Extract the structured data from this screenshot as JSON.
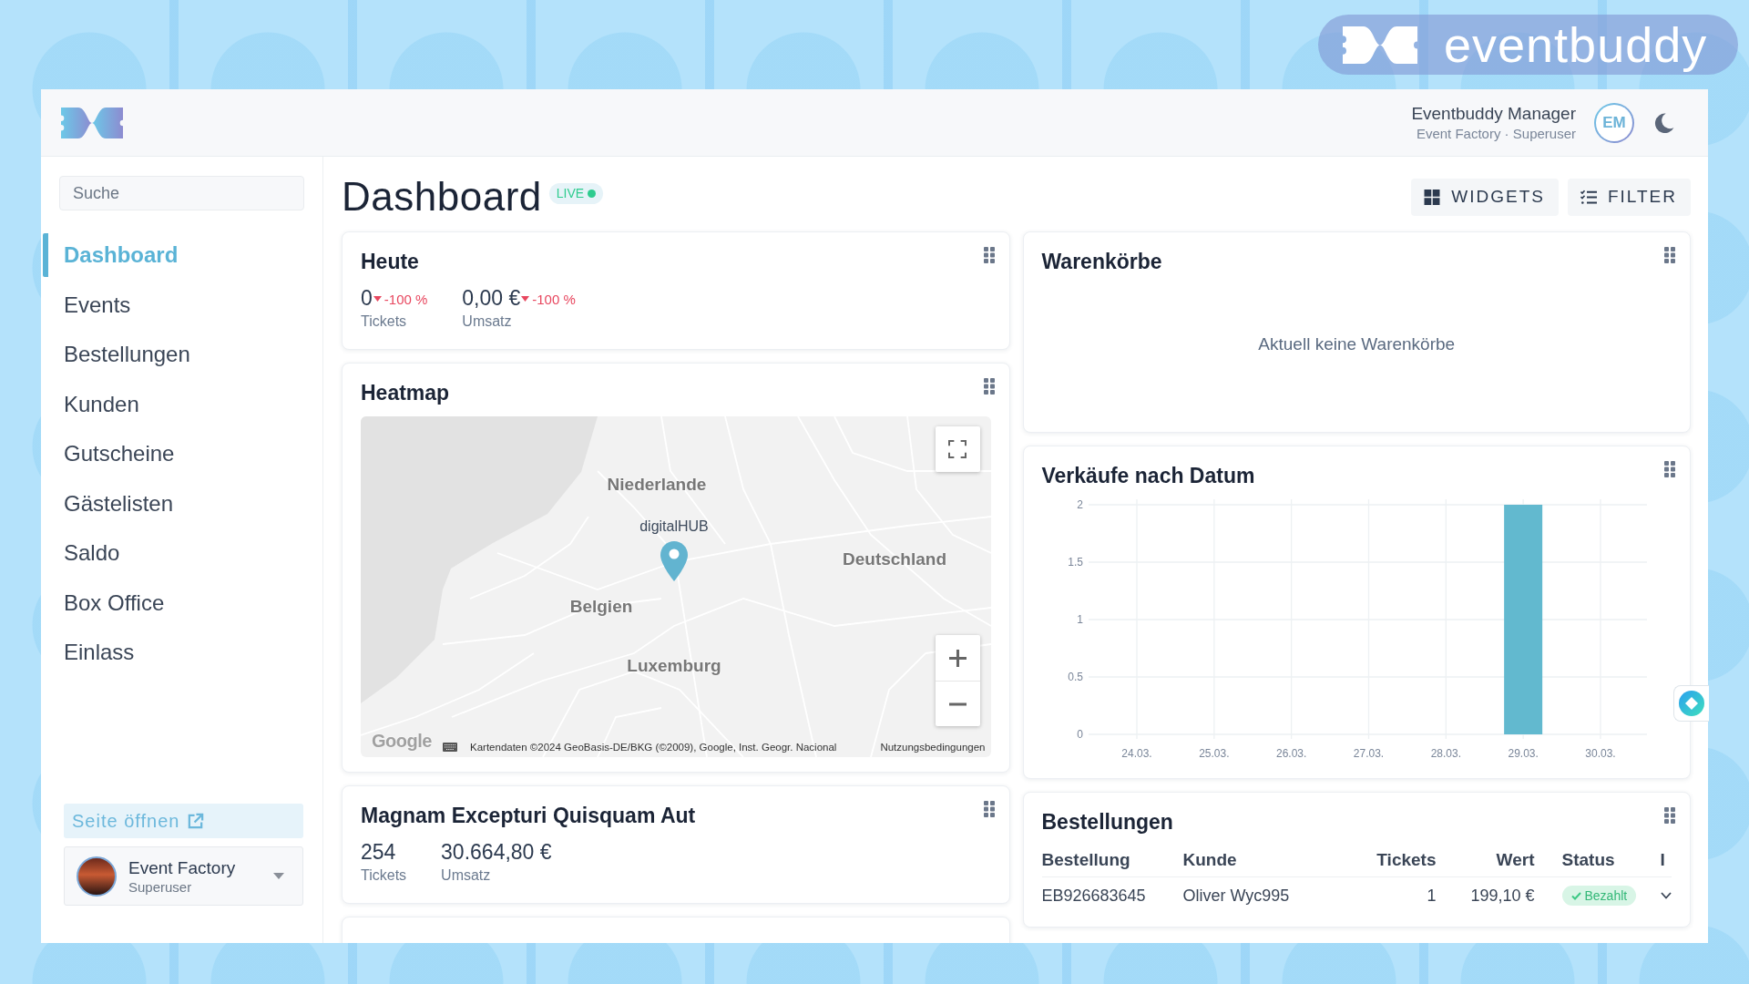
{
  "brand_badge": {
    "wordmark": "eventbuddy"
  },
  "header": {
    "user_name": "Eventbuddy Manager",
    "user_subtitle": "Event Factory · Superuser",
    "avatar_initials": "EM"
  },
  "sidebar": {
    "search": {
      "placeholder": "Suche"
    },
    "items": [
      {
        "label": "Dashboard",
        "selected": true
      },
      {
        "label": "Events",
        "selected": false
      },
      {
        "label": "Bestellungen",
        "selected": false
      },
      {
        "label": "Kunden",
        "selected": false
      },
      {
        "label": "Gutscheine",
        "selected": false
      },
      {
        "label": "Gästelisten",
        "selected": false
      },
      {
        "label": "Saldo",
        "selected": false
      },
      {
        "label": "Box Office",
        "selected": false
      },
      {
        "label": "Einlass",
        "selected": false
      }
    ],
    "open_site_button": "Seite öffnen",
    "organization": {
      "name": "Event Factory",
      "role": "Superuser"
    }
  },
  "page": {
    "title": "Dashboard",
    "live_badge": "LIVE",
    "buttons": [
      {
        "kind": "widgets",
        "label": "WIDGETS"
      },
      {
        "kind": "filter",
        "label": "FILTER"
      }
    ]
  },
  "widgets_left": [
    {
      "kind": "stats",
      "title": "Heute",
      "stats": [
        {
          "value": "0",
          "falling": true,
          "change": "-100 %",
          "label": "Tickets"
        },
        {
          "value": "0,00 €",
          "falling": true,
          "change": "-100 %",
          "label": "Umsatz"
        }
      ]
    },
    {
      "kind": "map",
      "title": "Heatmap",
      "map": {
        "country_labels": [
          "Niederlande",
          "Deutschland",
          "Belgien",
          "Luxemburg"
        ],
        "marker_label": "digitalHUB",
        "logo": "Google",
        "attribution": "Kartendaten ©2024 GeoBasis-DE/BKG (©2009), Google, Inst. Geogr. Nacional",
        "terms_link": "Nutzungsbedingungen"
      }
    },
    {
      "kind": "stats",
      "title": "Magnam Excepturi Quisquam Aut",
      "stats": [
        {
          "value": "254",
          "label": "Tickets"
        },
        {
          "value": "30.664,80 €",
          "label": "Umsatz"
        }
      ]
    },
    {
      "kind": "blank"
    }
  ],
  "widgets_right": [
    {
      "kind": "empty",
      "title": "Warenkörbe",
      "message": "Aktuell keine Warenkörbe"
    },
    {
      "kind": "chart",
      "title": "Verkäufe nach Datum",
      "chart_data": {
        "type": "bar",
        "categories": [
          "24.03.",
          "25.03.",
          "26.03.",
          "27.03.",
          "28.03.",
          "29.03.",
          "30.03."
        ],
        "series": [
          {
            "color": "#62b9cf",
            "values": [
              0,
              0,
              0,
              0,
              0,
              2,
              0
            ]
          }
        ],
        "ylim": [
          0,
          2
        ],
        "yticks": [
          0,
          0.5,
          1,
          1.5,
          2
        ],
        "grid": true
      }
    },
    {
      "kind": "table",
      "title": "Bestellungen",
      "columns": [
        "Bestellung",
        "Kunde",
        "Tickets",
        "Wert",
        "Status",
        "I"
      ],
      "rows": [
        {
          "order": "EB926683645",
          "customer": "Oliver Wyc995",
          "tickets": "1",
          "value": "199,10 €",
          "status": {
            "kind": "paid",
            "label": "Bezahlt"
          }
        }
      ]
    }
  ]
}
